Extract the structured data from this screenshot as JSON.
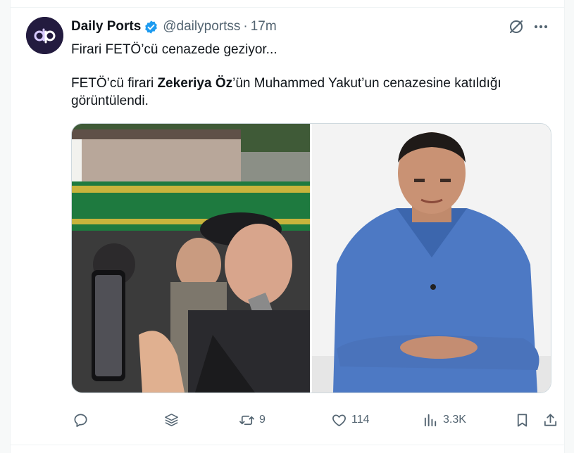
{
  "author": {
    "name": "Daily Ports",
    "handle": "@dailyportss",
    "separator": "·",
    "time": "17m",
    "avatar_letters": "dp",
    "verified_icon": "verified-badge-icon"
  },
  "tweet": {
    "line1": "Firari FETÖ’cü cenazede geziyor...",
    "line2_prefix": "FETÖ’cü firari ",
    "line2_bold": "Zekeriya Öz",
    "line2_suffix": "’ün Muhammed Yakut’un cenazesine katıldığı görüntülendi."
  },
  "actions": {
    "reply": {
      "icon": "reply-icon",
      "count": ""
    },
    "grok_share": {
      "icon": "stack-icon"
    },
    "retweet": {
      "icon": "retweet-icon",
      "count": "9"
    },
    "like": {
      "icon": "heart-icon",
      "count": "114"
    },
    "views": {
      "icon": "views-chart-icon",
      "count": "3.3K"
    },
    "bookmark": {
      "icon": "bookmark-icon"
    },
    "share": {
      "icon": "share-icon"
    }
  },
  "colors": {
    "accent": "#1d9bf0",
    "muted": "#536471",
    "text": "#0f1419"
  }
}
